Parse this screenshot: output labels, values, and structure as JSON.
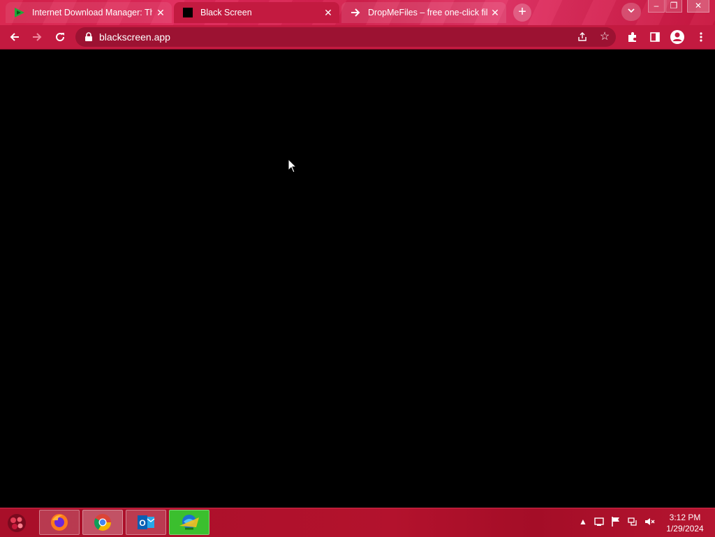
{
  "browser": {
    "tabs": [
      {
        "title": "Internet Download Manager: The",
        "favicon": "idm-play-icon",
        "active": false
      },
      {
        "title": "Black Screen",
        "favicon": "black-square-icon",
        "active": true
      },
      {
        "title": "DropMeFiles – free one-click file",
        "favicon": "arrow-right-icon",
        "active": false
      }
    ],
    "new_tab": "+",
    "address_bar": {
      "url": "blackscreen.app"
    },
    "theme_color": "#d8204a"
  },
  "page": {
    "background": "#000000"
  },
  "taskbar": {
    "apps": [
      "firefox-icon",
      "chrome-icon",
      "outlook-icon",
      "idm-icon"
    ],
    "clock": {
      "time": "3:12 PM",
      "date": "1/29/2024"
    }
  }
}
